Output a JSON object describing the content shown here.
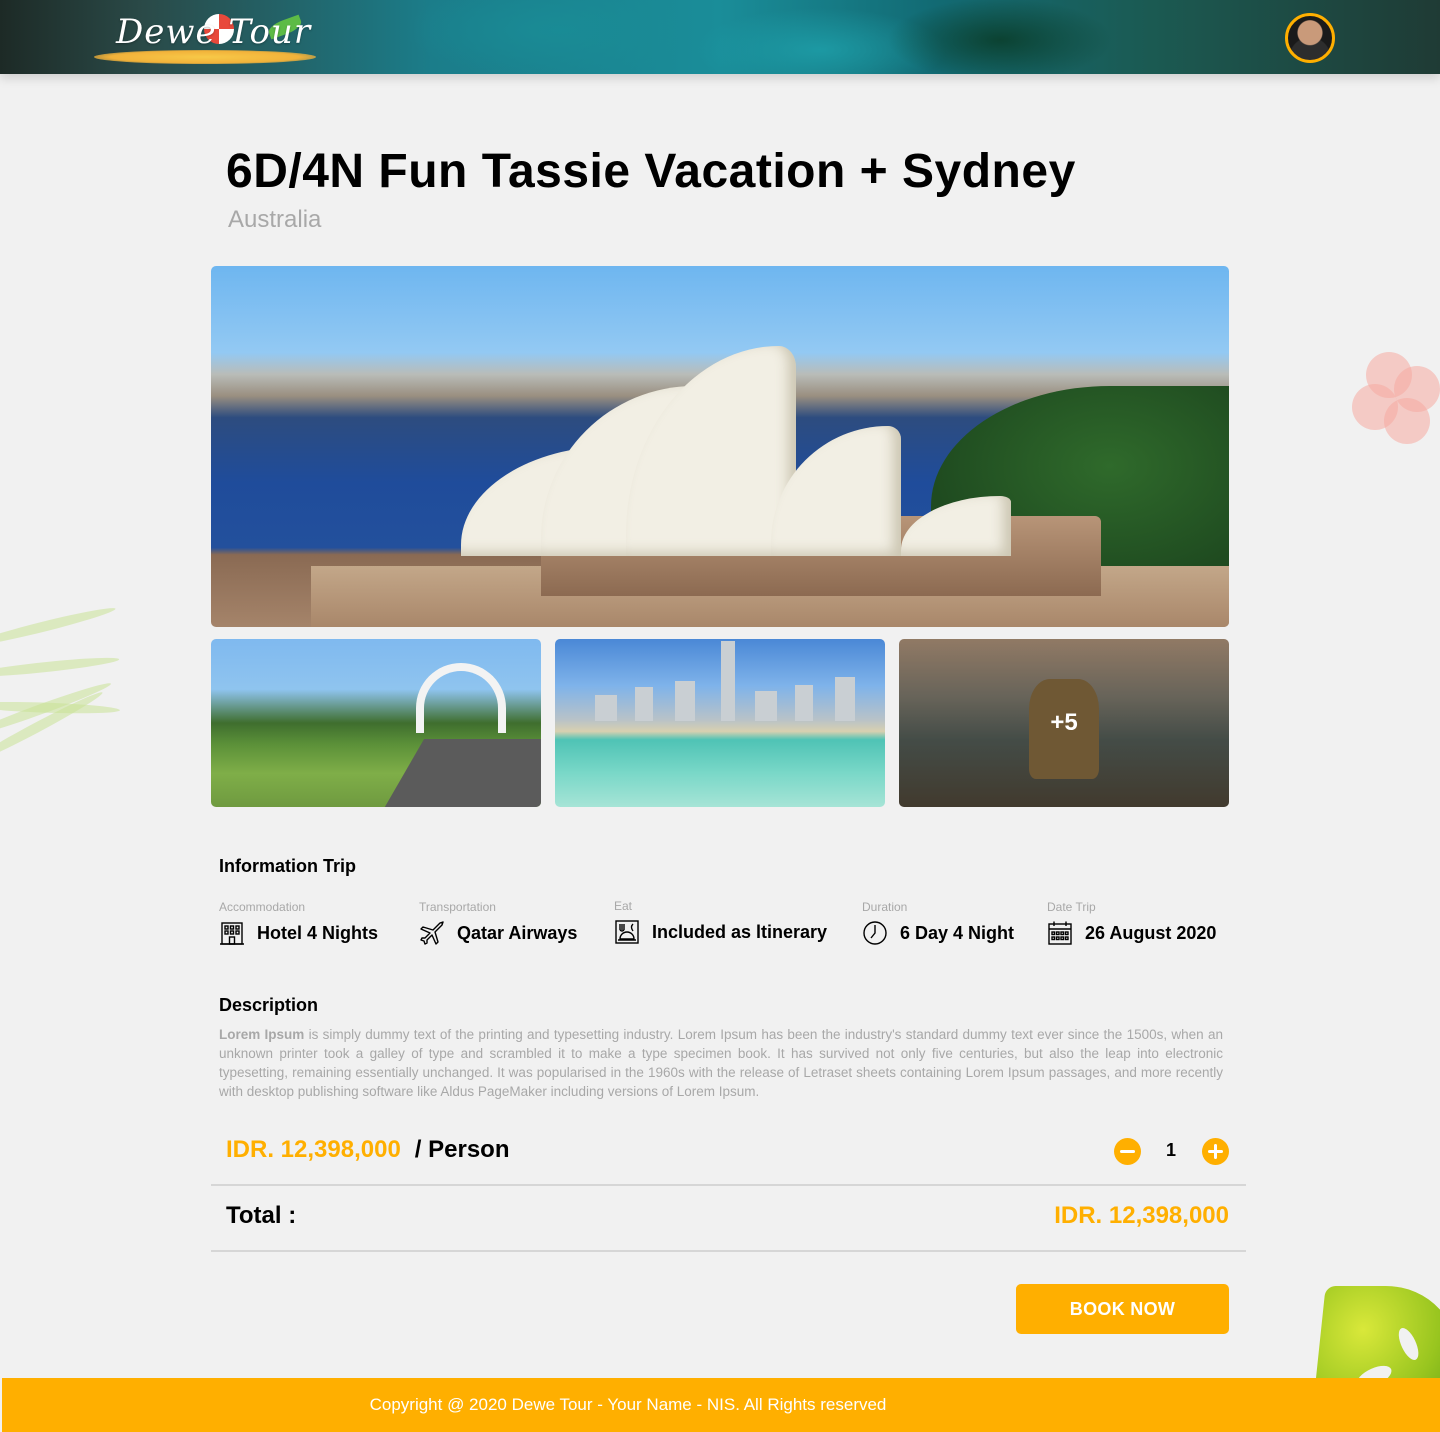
{
  "header": {
    "logo_text": "Dewe Tour",
    "avatar_icon": "user-avatar-icon"
  },
  "trip": {
    "title": "6D/4N Fun Tassie Vacation + Sydney",
    "country": "Australia",
    "more_photos": "+5"
  },
  "information": {
    "heading": "Information Trip",
    "items": [
      {
        "label": "Accommodation",
        "value": "Hotel 4 Nights",
        "icon": "hotel-icon"
      },
      {
        "label": "Transportation",
        "value": "Qatar Airways",
        "icon": "plane-icon"
      },
      {
        "label": "Eat",
        "value": "Included as ltinerary",
        "icon": "meal-icon"
      },
      {
        "label": "Duration",
        "value": "6 Day 4 Night",
        "icon": "clock-icon"
      },
      {
        "label": "Date Trip",
        "value": "26 August 2020",
        "icon": "calendar-icon"
      }
    ]
  },
  "description": {
    "heading": "Description",
    "lead": "Lorem Ipsum",
    "body": " is simply dummy text of the printing and typesetting industry. Lorem Ipsum has been the industry's standard dummy text ever since the 1500s, when an unknown printer took a galley of type and scrambled it to make a type specimen book.  It has survived not only five centuries, but also the leap into electronic typesetting, remaining essentially unchanged. It was popularised in the 1960s with the release of Letraset sheets containing Lorem Ipsum passages, and more recently with desktop publishing software like Aldus PageMaker including versions of Lorem Ipsum."
  },
  "pricing": {
    "price": "IDR. 12,398,000",
    "per": "/ Person",
    "quantity": "1",
    "total_label": "Total :",
    "total_value": "IDR. 12,398,000"
  },
  "actions": {
    "book_label": "BOOK NOW"
  },
  "footer": {
    "text": "Copyright @ 2020 Dewe Tour - Your Name - NIS. All Rights reserved"
  },
  "colors": {
    "accent": "#FFAF00",
    "background": "#F1F1F1",
    "muted_text": "#A8A8A8"
  }
}
